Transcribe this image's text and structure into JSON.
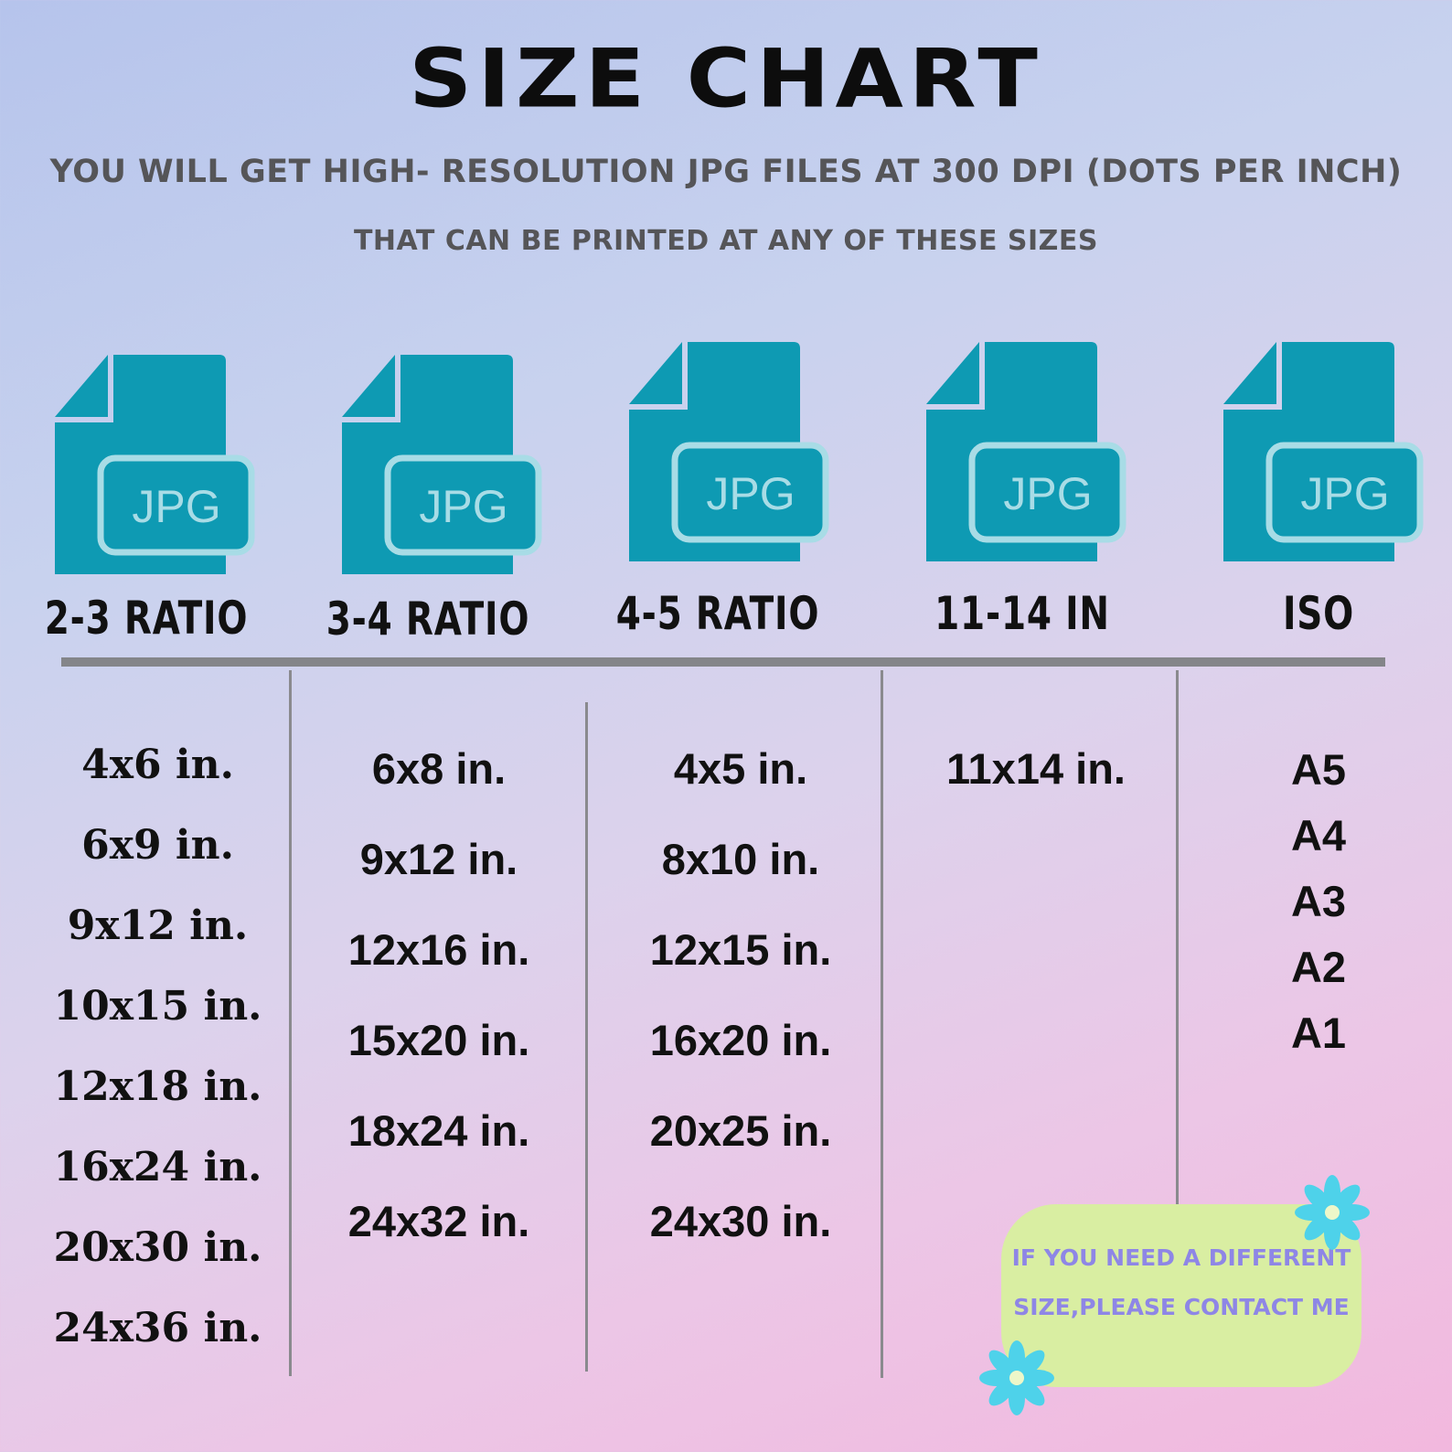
{
  "title": "Size Chart",
  "subtitle_line1": "YOU WILL GET HIGH- RESOLUTION JPG FILES AT 300 DPI (DOTS PER INCH)",
  "subtitle_line2": "THAT CAN BE PRINTED AT ANY OF THESE SIZES",
  "file_icon_label": "JPG",
  "colors": {
    "icon_fill": "#0e9ab3",
    "icon_outline": "#a8dce6",
    "rule": "#848589",
    "contact_bg": "#d9eea2",
    "contact_text": "#8e86e6",
    "flower": "#4ed2ea"
  },
  "columns": [
    {
      "heading": "2-3 RATIO",
      "sizes": [
        "4x6 in.",
        "6x9 in.",
        "9x12 in.",
        "10x15 in.",
        "12x18 in.",
        "16x24 in.",
        "20x30 in.",
        "24x36 in."
      ]
    },
    {
      "heading": "3-4 RATIO",
      "sizes": [
        "6x8 in.",
        "9x12 in.",
        "12x16 in.",
        "15x20 in.",
        "18x24 in.",
        "24x32 in."
      ]
    },
    {
      "heading": "4-5 RATIO",
      "sizes": [
        "4x5 in.",
        "8x10 in.",
        "12x15 in.",
        "16x20 in.",
        "20x25 in.",
        "24x30 in."
      ]
    },
    {
      "heading": "11-14 IN",
      "sizes": [
        "11x14 in."
      ]
    },
    {
      "heading": "ISO",
      "sizes": [
        "A5",
        "A4",
        "A3",
        "A2",
        "A1"
      ]
    }
  ],
  "contact": {
    "line1": "IF YOU NEED A DIFFERENT",
    "line2": "SIZE,PLEASE CONTACT ME"
  }
}
